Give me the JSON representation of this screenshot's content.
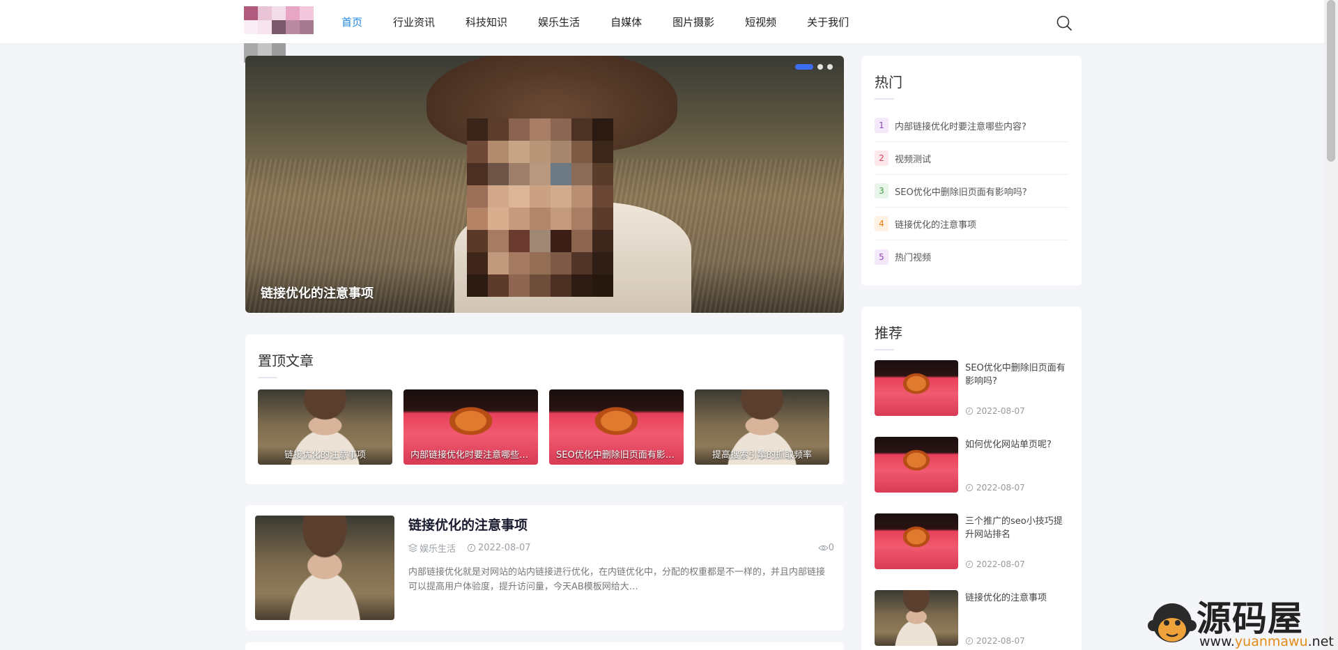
{
  "nav": {
    "items": [
      {
        "label": "首页"
      },
      {
        "label": "行业资讯"
      },
      {
        "label": "科技知识"
      },
      {
        "label": "娱乐生活"
      },
      {
        "label": "自媒体"
      },
      {
        "label": "图片摄影"
      },
      {
        "label": "短视频"
      },
      {
        "label": "关于我们"
      }
    ],
    "active_index": 0,
    "active_color": "#1e88e5",
    "search_icon": "search-icon"
  },
  "slider": {
    "caption": "链接优化的注意事项",
    "dot_count": 3,
    "active_dot": 0,
    "dot_active_color": "#3d6df2"
  },
  "pinned": {
    "title": "置顶文章",
    "items": [
      {
        "caption": "链接优化的注意事项",
        "thumb": "woman"
      },
      {
        "caption": "内部链接优化时要注意哪些内容?",
        "thumb": "red"
      },
      {
        "caption": "SEO优化中删除旧页面有影响吗?",
        "thumb": "red"
      },
      {
        "caption": "提高搜索引擎的抓取频率",
        "thumb": "woman"
      }
    ]
  },
  "post": {
    "title": "链接优化的注意事项",
    "category": "娱乐生活",
    "date": "2022-08-07",
    "views": "0",
    "excerpt": "内部链接优化就是对网站的站内链接进行优化，在内链优化中，分配的权重都是不一样的，并且内部链接可以提高用户体验度，提升访问量，今天AB模板网给大…"
  },
  "hot": {
    "title": "热门",
    "items": [
      {
        "rank": "1",
        "text": "内部链接优化时要注意哪些内容?",
        "rank_bg": "#f3e9fb",
        "rank_color": "#8e44ad"
      },
      {
        "rank": "2",
        "text": "视频测试",
        "rank_bg": "#fde9ec",
        "rank_color": "#e0405c"
      },
      {
        "rank": "3",
        "text": "SEO优化中删除旧页面有影响吗?",
        "rank_bg": "#e8f5e9",
        "rank_color": "#43a047"
      },
      {
        "rank": "4",
        "text": "链接优化的注意事项",
        "rank_bg": "#fff1e3",
        "rank_color": "#ef7d0d"
      },
      {
        "rank": "5",
        "text": "热门视频",
        "rank_bg": "#f3e9fb",
        "rank_color": "#8e44ad"
      }
    ]
  },
  "recommend": {
    "title": "推荐",
    "items": [
      {
        "title": "SEO优化中删除旧页面有影响吗?",
        "date": "2022-08-07",
        "thumb": "red"
      },
      {
        "title": "如何优化网站单页呢?",
        "date": "2022-08-07",
        "thumb": "red"
      },
      {
        "title": "三个推广的seo小技巧提升网站排名",
        "date": "2022-08-07",
        "thumb": "red"
      },
      {
        "title": "链接优化的注意事项",
        "date": "2022-08-07",
        "thumb": "woman"
      }
    ]
  },
  "watermark": {
    "text": "源码屋",
    "url_prefix": "www.",
    "url_mid": "yuanmawu",
    "url_suffix": ".net"
  }
}
